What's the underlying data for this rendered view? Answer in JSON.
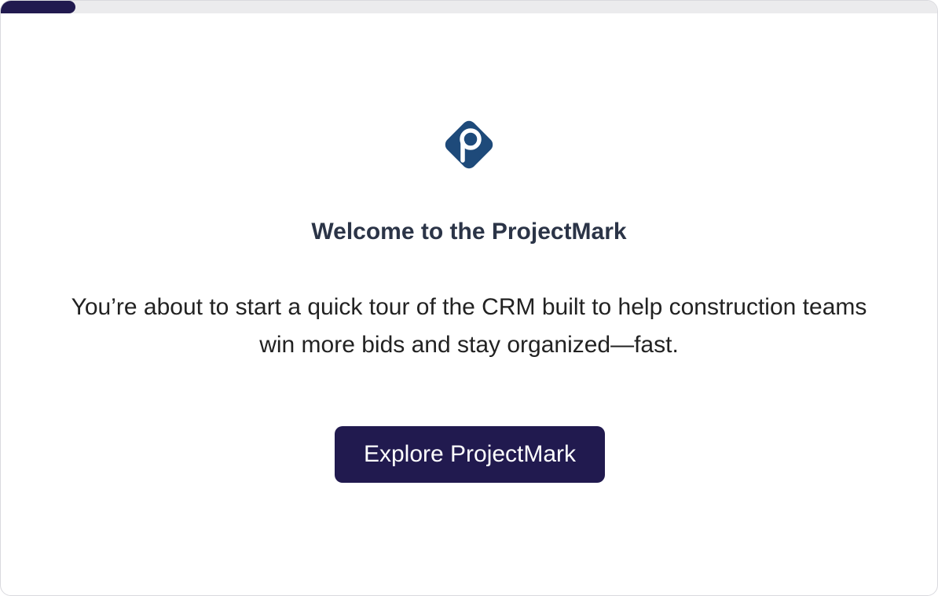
{
  "colors": {
    "accent": "#211a4f",
    "logo": "#1e4a7a",
    "title": "#2b3447",
    "progress_track": "#ebebed"
  },
  "progress": {
    "fraction": 0.08
  },
  "logo": {
    "icon": "projectmark-logo-icon"
  },
  "welcome": {
    "title": "Welcome to the ProjectMark",
    "description": "You’re about to start a quick tour of the CRM built to help construction teams win more bids and stay organized—fast.",
    "button_label": "Explore ProjectMark"
  }
}
